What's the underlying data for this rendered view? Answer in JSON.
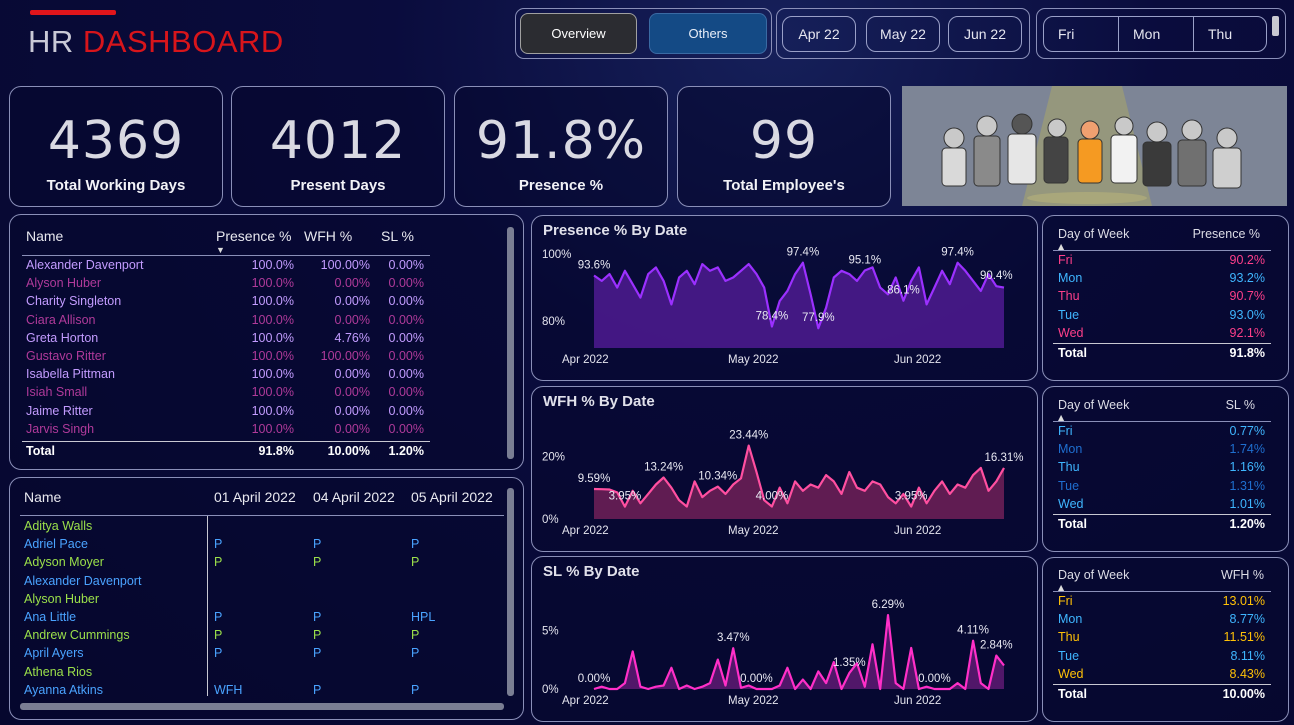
{
  "header": {
    "title_hr": "HR",
    "title_dashboard": "DASHBOARD",
    "nav": {
      "overview": "Overview",
      "others": "Others"
    },
    "months": [
      "Apr 22",
      "May 22",
      "Jun 22"
    ],
    "days": [
      "Fri",
      "Mon",
      "Thu"
    ]
  },
  "kpis": [
    {
      "value": "4369",
      "label": "Total Working Days"
    },
    {
      "value": "4012",
      "label": "Present Days"
    },
    {
      "value": "91.8%",
      "label": "Presence %"
    },
    {
      "value": "99",
      "label": "Total Employee's"
    }
  ],
  "employee_table": {
    "headers": {
      "name": "Name",
      "presence": "Presence %",
      "wfh": "WFH %",
      "sl": "SL %"
    },
    "rows": [
      {
        "name": "Alexander Davenport",
        "presence": "100.0%",
        "wfh": "100.00%",
        "sl": "0.00%",
        "color": "#c39cff"
      },
      {
        "name": "Alyson Huber",
        "presence": "100.0%",
        "wfh": "0.00%",
        "sl": "0.00%",
        "color": "#b03a9a"
      },
      {
        "name": "Charity Singleton",
        "presence": "100.0%",
        "wfh": "0.00%",
        "sl": "0.00%",
        "color": "#c39cff"
      },
      {
        "name": "Ciara Allison",
        "presence": "100.0%",
        "wfh": "0.00%",
        "sl": "0.00%",
        "color": "#b03a9a"
      },
      {
        "name": "Greta Horton",
        "presence": "100.0%",
        "wfh": "4.76%",
        "sl": "0.00%",
        "color": "#c39cff"
      },
      {
        "name": "Gustavo Ritter",
        "presence": "100.0%",
        "wfh": "100.00%",
        "sl": "0.00%",
        "color": "#b03a9a"
      },
      {
        "name": "Isabella Pittman",
        "presence": "100.0%",
        "wfh": "0.00%",
        "sl": "0.00%",
        "color": "#c39cff"
      },
      {
        "name": "Isiah Small",
        "presence": "100.0%",
        "wfh": "0.00%",
        "sl": "0.00%",
        "color": "#b03a9a"
      },
      {
        "name": "Jaime Ritter",
        "presence": "100.0%",
        "wfh": "0.00%",
        "sl": "0.00%",
        "color": "#c39cff"
      },
      {
        "name": "Jarvis Singh",
        "presence": "100.0%",
        "wfh": "0.00%",
        "sl": "0.00%",
        "color": "#b03a9a"
      }
    ],
    "total": {
      "name": "Total",
      "presence": "91.8%",
      "wfh": "10.00%",
      "sl": "1.20%"
    }
  },
  "attendance_matrix": {
    "headers": [
      "Name",
      "01 April 2022",
      "04 April 2022",
      "05 April 2022"
    ],
    "rows": [
      {
        "name": "Aditya Walls",
        "c1": "",
        "c2": "",
        "c3": "",
        "color": "#9be04a"
      },
      {
        "name": "Adriel Pace",
        "c1": "P",
        "c2": "P",
        "c3": "P",
        "color": "#4aa3ff"
      },
      {
        "name": "Adyson Moyer",
        "c1": "P",
        "c2": "P",
        "c3": "P",
        "color": "#9be04a"
      },
      {
        "name": "Alexander Davenport",
        "c1": "",
        "c2": "",
        "c3": "",
        "color": "#4aa3ff"
      },
      {
        "name": "Alyson Huber",
        "c1": "",
        "c2": "",
        "c3": "",
        "color": "#9be04a"
      },
      {
        "name": "Ana Little",
        "c1": "P",
        "c2": "P",
        "c3": "HPL",
        "color": "#4aa3ff"
      },
      {
        "name": "Andrew Cummings",
        "c1": "P",
        "c2": "P",
        "c3": "P",
        "color": "#9be04a"
      },
      {
        "name": "April Ayers",
        "c1": "P",
        "c2": "P",
        "c3": "P",
        "color": "#4aa3ff"
      },
      {
        "name": "Athena Rios",
        "c1": "",
        "c2": "",
        "c3": "",
        "color": "#9be04a"
      },
      {
        "name": "Ayanna Atkins",
        "c1": "WFH",
        "c2": "P",
        "c3": "P",
        "color": "#4aa3ff"
      }
    ]
  },
  "presence_table": {
    "headers": {
      "day": "Day of Week",
      "value": "Presence %"
    },
    "rows": [
      {
        "day": "Fri",
        "value": "90.2%",
        "color": "#ff3f8a"
      },
      {
        "day": "Mon",
        "value": "93.2%",
        "color": "#3fb6ff"
      },
      {
        "day": "Thu",
        "value": "90.7%",
        "color": "#ff3f8a"
      },
      {
        "day": "Tue",
        "value": "93.0%",
        "color": "#3fb6ff"
      },
      {
        "day": "Wed",
        "value": "92.1%",
        "color": "#ff3f8a"
      }
    ],
    "total": {
      "day": "Total",
      "value": "91.8%"
    }
  },
  "sl_table": {
    "headers": {
      "day": "Day of Week",
      "value": "SL %"
    },
    "rows": [
      {
        "day": "Fri",
        "value": "0.77%",
        "color": "#3fb6ff"
      },
      {
        "day": "Mon",
        "value": "1.74%",
        "color": "#1f6fd0"
      },
      {
        "day": "Thu",
        "value": "1.16%",
        "color": "#3fb6ff"
      },
      {
        "day": "Tue",
        "value": "1.31%",
        "color": "#1f6fd0"
      },
      {
        "day": "Wed",
        "value": "1.01%",
        "color": "#3fb6ff"
      }
    ],
    "total": {
      "day": "Total",
      "value": "1.20%"
    }
  },
  "wfh_table": {
    "headers": {
      "day": "Day of Week",
      "value": "WFH %"
    },
    "rows": [
      {
        "day": "Fri",
        "value": "13.01%",
        "color": "#ffc107"
      },
      {
        "day": "Mon",
        "value": "8.77%",
        "color": "#3fb6ff"
      },
      {
        "day": "Thu",
        "value": "11.51%",
        "color": "#ffc107"
      },
      {
        "day": "Tue",
        "value": "8.11%",
        "color": "#3fb6ff"
      },
      {
        "day": "Wed",
        "value": "8.43%",
        "color": "#ffc107"
      }
    ],
    "total": {
      "day": "Total",
      "value": "10.00%"
    }
  },
  "chart_data": [
    {
      "type": "area",
      "title": "Presence % By Date",
      "ylim": [
        72,
        100
      ],
      "yticks": [
        {
          "value": 100,
          "label": "100%"
        },
        {
          "value": 80,
          "label": "80%"
        }
      ],
      "xticks": [
        "Apr 2022",
        "May 2022",
        "Jun 2022"
      ],
      "color": "#9b30ff",
      "fill": "#4a1a8c",
      "values": [
        93.6,
        92,
        94,
        90,
        95,
        91,
        87,
        94,
        96,
        92,
        85,
        93,
        95,
        91,
        97,
        95,
        96,
        92,
        93,
        95,
        97,
        94,
        90,
        78.4,
        86,
        89,
        94,
        97.4,
        88,
        77.9,
        84,
        93,
        95,
        94,
        92,
        95.1,
        96,
        90,
        88,
        93,
        86.1,
        92,
        96,
        85,
        90,
        95,
        91,
        97.4,
        95,
        92,
        89,
        94,
        90.4,
        90
      ],
      "labels": [
        {
          "i": 0,
          "text": "93.6%"
        },
        {
          "i": 23,
          "text": "78.4%"
        },
        {
          "i": 27,
          "text": "97.4%"
        },
        {
          "i": 29,
          "text": "77.9%"
        },
        {
          "i": 35,
          "text": "95.1%"
        },
        {
          "i": 40,
          "text": "86.1%"
        },
        {
          "i": 47,
          "text": "97.4%"
        },
        {
          "i": 52,
          "text": "90.4%"
        }
      ]
    },
    {
      "type": "area",
      "title": "WFH % By Date",
      "ylim": [
        0,
        30
      ],
      "yticks": [
        {
          "value": 20,
          "label": "20%"
        },
        {
          "value": 0,
          "label": "0%"
        }
      ],
      "xticks": [
        "Apr 2022",
        "May 2022",
        "Jun 2022"
      ],
      "color": "#ff4fa0",
      "fill": "#6a1f55",
      "values": [
        9.59,
        9.5,
        9.4,
        8.5,
        3.95,
        9,
        5,
        8,
        11,
        13.24,
        10,
        6,
        4,
        12,
        7,
        9,
        10.34,
        8,
        11,
        13,
        23.44,
        15,
        6,
        4.0,
        10,
        5,
        12,
        9,
        11,
        10,
        14,
        12,
        8,
        15,
        10,
        9,
        12,
        11,
        7,
        5,
        8,
        3.95,
        10,
        5,
        9,
        12,
        8,
        11,
        10,
        14,
        16.31,
        9,
        12,
        16.31
      ],
      "labels": [
        {
          "i": 0,
          "text": "9.59%"
        },
        {
          "i": 4,
          "text": "3.95%"
        },
        {
          "i": 9,
          "text": "13.24%"
        },
        {
          "i": 16,
          "text": "10.34%"
        },
        {
          "i": 20,
          "text": "23.44%"
        },
        {
          "i": 23,
          "text": "4.00%"
        },
        {
          "i": 41,
          "text": "3.95%"
        },
        {
          "i": 53,
          "text": "16.31%"
        }
      ]
    },
    {
      "type": "area",
      "title": "SL % By Date",
      "ylim": [
        0,
        8
      ],
      "yticks": [
        {
          "value": 5,
          "label": "5%"
        },
        {
          "value": 0,
          "label": "0%"
        }
      ],
      "xticks": [
        "Apr 2022",
        "May 2022",
        "Jun 2022"
      ],
      "color": "#ff2fc8",
      "fill": "#5a1a70",
      "values": [
        0.0,
        0.2,
        0.0,
        0.0,
        0.5,
        3.2,
        0.2,
        0.0,
        0.2,
        0.3,
        1.8,
        0.0,
        0.3,
        0.0,
        0.2,
        0.5,
        2.5,
        0.3,
        3.47,
        0.1,
        0.3,
        0.0,
        0.0,
        0.0,
        0.3,
        1.8,
        0.0,
        0.8,
        0.0,
        1.5,
        0.5,
        2.3,
        0.0,
        1.35,
        2.2,
        0.2,
        3.8,
        0.0,
        6.29,
        0.5,
        0.0,
        3.5,
        0.0,
        0.2,
        0.0,
        0.0,
        0.0,
        0.5,
        0.0,
        4.11,
        0.5,
        0.0,
        2.84,
        2.0
      ],
      "labels": [
        {
          "i": 0,
          "text": "0.00%"
        },
        {
          "i": 18,
          "text": "3.47%"
        },
        {
          "i": 21,
          "text": "0.00%"
        },
        {
          "i": 33,
          "text": "1.35%"
        },
        {
          "i": 38,
          "text": "6.29%"
        },
        {
          "i": 44,
          "text": "0.00%"
        },
        {
          "i": 49,
          "text": "4.11%"
        },
        {
          "i": 52,
          "text": "2.84%"
        }
      ]
    }
  ]
}
